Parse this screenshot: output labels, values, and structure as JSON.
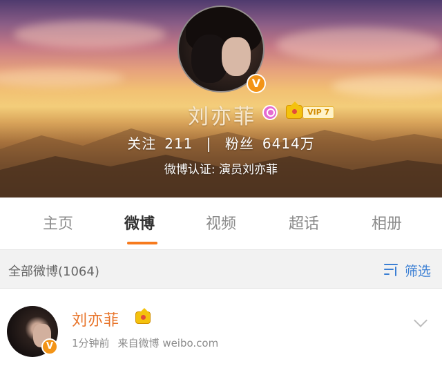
{
  "profile": {
    "name": "刘亦菲",
    "vip_label": "VIP 7",
    "following_label": "关注",
    "following_count": "211",
    "separator": "|",
    "followers_label": "粉丝",
    "followers_count": "6414万",
    "verification": "微博认证: 演员刘亦菲",
    "verified_badge": "V"
  },
  "tabs": [
    {
      "label": "主页"
    },
    {
      "label": "微博"
    },
    {
      "label": "视频"
    },
    {
      "label": "超话"
    },
    {
      "label": "相册"
    }
  ],
  "active_tab_index": 1,
  "filterbar": {
    "label": "全部微博(1064)",
    "filter_button": "筛选"
  },
  "post": {
    "author": "刘亦菲",
    "verified_badge": "V",
    "time": "1分钟前",
    "source": "来自微博 weibo.com"
  },
  "colors": {
    "accent_orange": "#f77a1d",
    "link_blue": "#3b7fd4",
    "author_orange": "#e8742a",
    "verified_orange": "#f39417"
  },
  "icons": [
    "search-badge-icon",
    "crown-icon",
    "verified-v-icon",
    "filter-icon",
    "chevron-down-icon"
  ]
}
